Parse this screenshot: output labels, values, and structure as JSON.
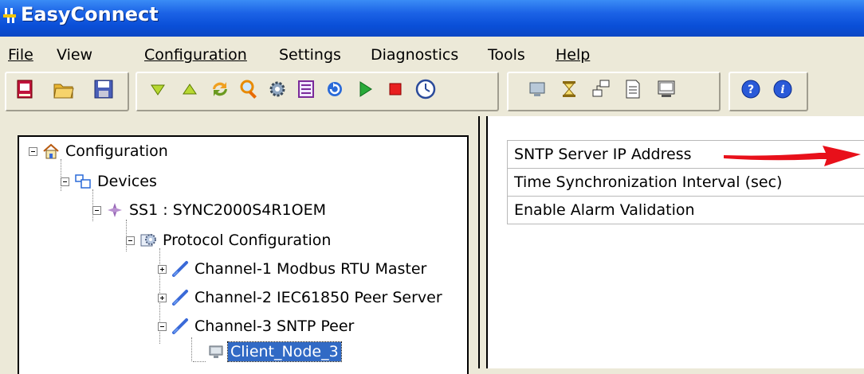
{
  "window": {
    "title": "EasyConnect"
  },
  "menu": {
    "items": [
      {
        "label": "File"
      },
      {
        "label": "View"
      },
      {
        "label": "Configuration"
      },
      {
        "label": "Settings"
      },
      {
        "label": "Diagnostics"
      },
      {
        "label": "Tools"
      },
      {
        "label": "Help"
      }
    ]
  },
  "toolbar": {
    "icons": [
      "new-icon",
      "open-folder-icon",
      "save-icon",
      "download-icon",
      "upload-icon",
      "sync-icon",
      "search-icon",
      "settings-gear-icon",
      "list-icon",
      "refresh-icon",
      "play-icon",
      "stop-icon",
      "clock-icon",
      "monitor-icon",
      "hourglass-icon",
      "network-icon",
      "document-icon",
      "terminal-icon",
      "help-icon",
      "info-icon"
    ]
  },
  "tree": {
    "nodes": [
      {
        "label": "Configuration"
      },
      {
        "label": "Devices"
      },
      {
        "label": "SS1 : SYNC2000S4R1OEM"
      },
      {
        "label": "Protocol Configuration"
      },
      {
        "label": "Channel-1 Modbus RTU Master"
      },
      {
        "label": "Channel-2 IEC61850 Peer Server"
      },
      {
        "label": "Channel-3 SNTP Peer"
      },
      {
        "label": "Client_Node_3"
      }
    ]
  },
  "properties": {
    "rows": [
      {
        "label": "SNTP Server IP Address"
      },
      {
        "label": "Time Synchronization Interval (sec)"
      },
      {
        "label": "Enable Alarm Validation"
      }
    ]
  },
  "colors": {
    "titlebar": "#0a4fd8",
    "selection": "#316ac5",
    "arrow": "#e8101a"
  }
}
